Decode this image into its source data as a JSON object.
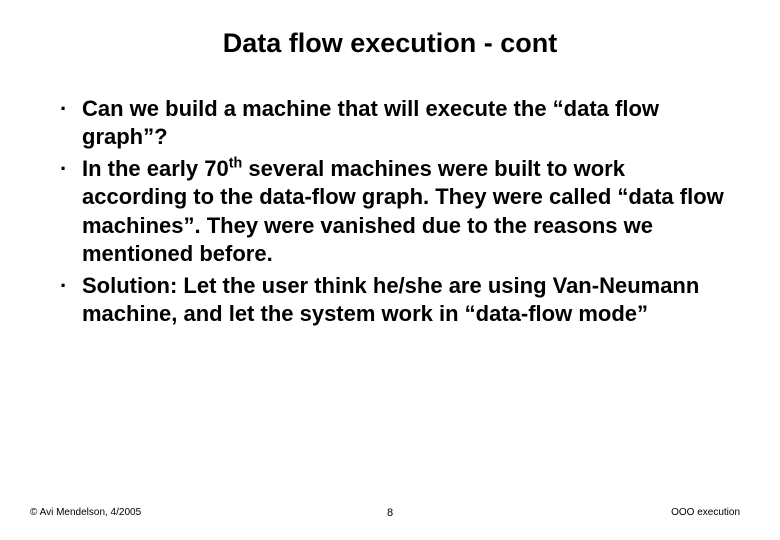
{
  "title": "Data flow execution - cont",
  "bullets": [
    {
      "text": "Can we build a machine that will execute the “data flow graph”?"
    },
    {
      "text_pre": "In the early 70",
      "sup": "th",
      "text_post": " several machines were built to work according to the data-flow graph. They were called “data flow machines”. They were vanished due to the reasons we mentioned before."
    },
    {
      "text": "Solution: Let the user think he/she are using Van-Neumann machine, and let the system work in “data-flow mode”"
    }
  ],
  "footer": {
    "left": "© Avi Mendelson, 4/2005",
    "center": "8",
    "right": "OOO execution"
  },
  "bullet_glyph": "·"
}
